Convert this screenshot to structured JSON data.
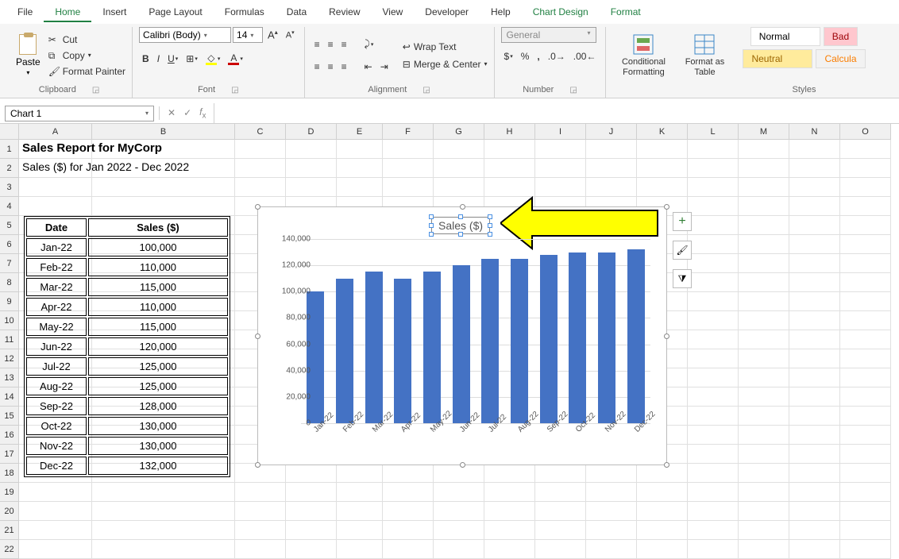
{
  "menu": {
    "file": "File",
    "home": "Home",
    "insert": "Insert",
    "pagelayout": "Page Layout",
    "formulas": "Formulas",
    "data": "Data",
    "review": "Review",
    "view": "View",
    "developer": "Developer",
    "help": "Help",
    "chartdesign": "Chart Design",
    "format": "Format"
  },
  "ribbon": {
    "clipboard": {
      "paste": "Paste",
      "cut": "Cut",
      "copy": "Copy",
      "fp": "Format Painter",
      "label": "Clipboard"
    },
    "font": {
      "name": "Calibri (Body)",
      "size": "14",
      "label": "Font"
    },
    "alignment": {
      "wrap": "Wrap Text",
      "merge": "Merge & Center",
      "label": "Alignment"
    },
    "number": {
      "format": "General",
      "label": "Number"
    },
    "cond": "Conditional Formatting",
    "fat": "Format as Table",
    "styles": {
      "normal": "Normal",
      "bad": "Bad",
      "neutral": "Neutral",
      "calc": "Calcula",
      "label": "Styles"
    }
  },
  "namebox": "Chart 1",
  "columns": [
    "A",
    "B",
    "C",
    "D",
    "E",
    "F",
    "G",
    "H",
    "I",
    "J",
    "K",
    "L",
    "M",
    "N",
    "O"
  ],
  "title": "Sales Report for MyCorp",
  "subtitle": "Sales ($) for Jan 2022 - Dec 2022",
  "table": {
    "hdr_date": "Date",
    "hdr_sales": "Sales ($)",
    "rows": [
      {
        "d": "Jan-22",
        "v": "100,000"
      },
      {
        "d": "Feb-22",
        "v": "110,000"
      },
      {
        "d": "Mar-22",
        "v": "115,000"
      },
      {
        "d": "Apr-22",
        "v": "110,000"
      },
      {
        "d": "May-22",
        "v": "115,000"
      },
      {
        "d": "Jun-22",
        "v": "120,000"
      },
      {
        "d": "Jul-22",
        "v": "125,000"
      },
      {
        "d": "Aug-22",
        "v": "125,000"
      },
      {
        "d": "Sep-22",
        "v": "128,000"
      },
      {
        "d": "Oct-22",
        "v": "130,000"
      },
      {
        "d": "Nov-22",
        "v": "130,000"
      },
      {
        "d": "Dec-22",
        "v": "132,000"
      }
    ]
  },
  "chart_data": {
    "type": "bar",
    "title": "Sales ($)",
    "categories": [
      "Jan-22",
      "Feb-22",
      "Mar-22",
      "Apr-22",
      "May-22",
      "Jun-22",
      "Jul-22",
      "Aug-22",
      "Sep-22",
      "Oct-22",
      "Nov-22",
      "Dec-22"
    ],
    "values": [
      100000,
      110000,
      115000,
      110000,
      115000,
      120000,
      125000,
      125000,
      128000,
      130000,
      130000,
      132000
    ],
    "ylim": [
      0,
      140000
    ],
    "yticks": [
      0,
      20000,
      40000,
      60000,
      80000,
      100000,
      120000,
      140000
    ],
    "yticklabels": [
      "0",
      "20,000",
      "40,000",
      "60,000",
      "80,000",
      "100,000",
      "120,000",
      "140,000"
    ]
  }
}
